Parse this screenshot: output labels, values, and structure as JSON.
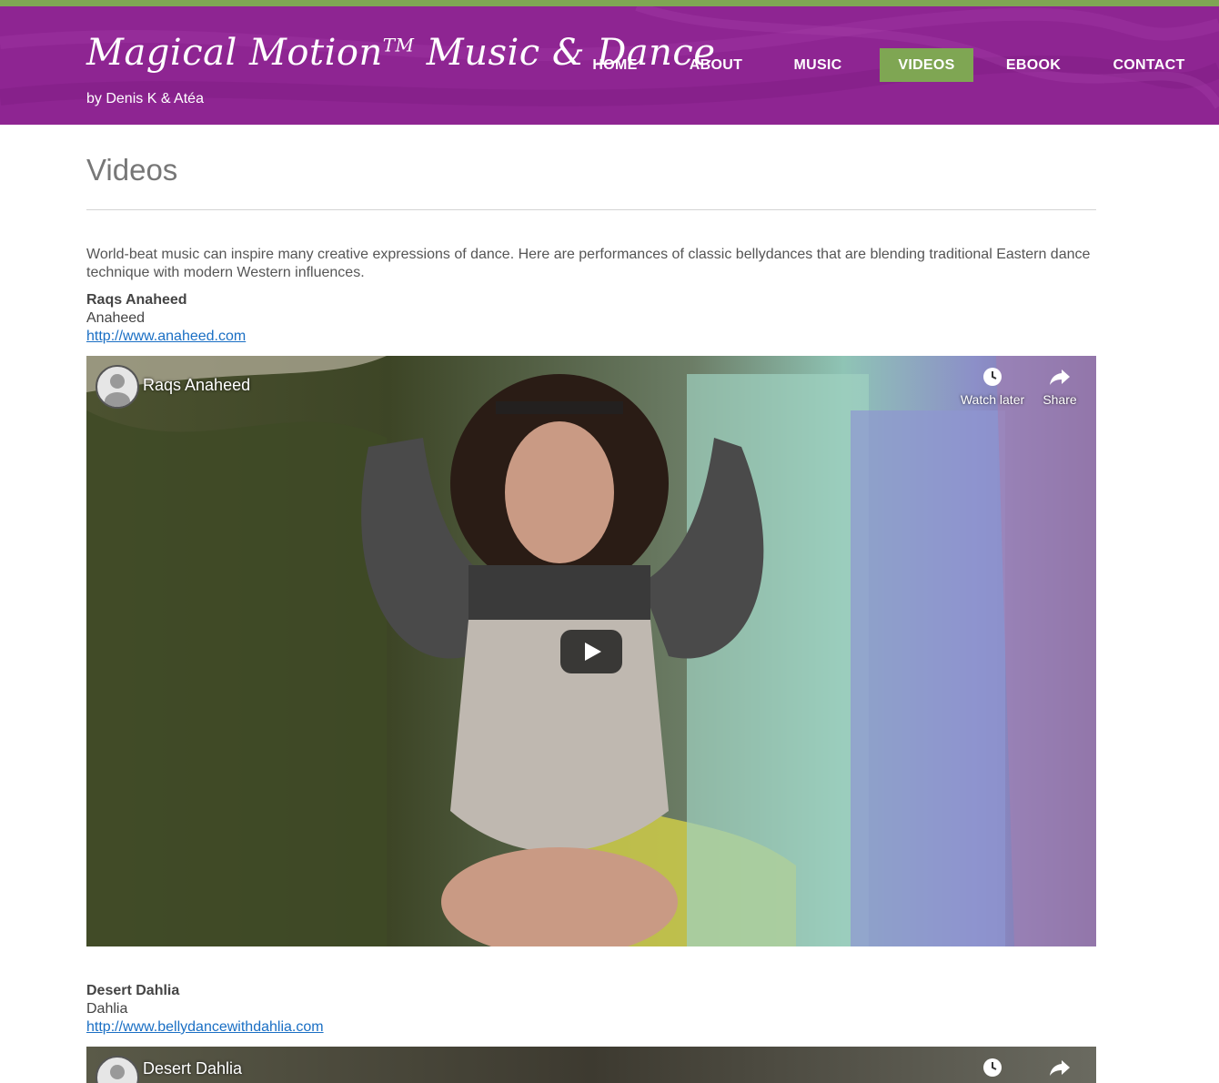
{
  "site": {
    "logo_text": "Magical Motion",
    "logo_tm": "TM",
    "logo_rest": " Music & Dance",
    "tagline": "by Denis K & Atéa"
  },
  "nav": {
    "items": [
      {
        "label": "HOME"
      },
      {
        "label": "ABOUT"
      },
      {
        "label": "MUSIC"
      },
      {
        "label": "VIDEOS",
        "active": true
      },
      {
        "label": "EBOOK"
      },
      {
        "label": "CONTACT"
      }
    ]
  },
  "colors": {
    "header": "#8e2592",
    "accent": "#7fa653",
    "link": "#1a6fc4"
  },
  "page": {
    "title": "Videos",
    "intro": "World-beat music can inspire many creative expressions of dance. Here are performances of classic bellydances that are blending traditional Eastern dance technique with modern Western influences."
  },
  "entries": [
    {
      "title": "Raqs Anaheed",
      "artist": "Anaheed",
      "link": "http://www.anaheed.com",
      "video_title": "Raqs Anaheed",
      "watch_later": "Watch later",
      "share": "Share"
    },
    {
      "title": "Desert Dahlia",
      "artist": "Dahlia",
      "link": "http://www.bellydancewithdahlia.com",
      "video_title": "Desert Dahlia"
    }
  ],
  "icons": {
    "watch_later": "clock-icon",
    "share": "share-arrow-icon",
    "play": "play-icon",
    "avatar": "channel-avatar-icon"
  }
}
